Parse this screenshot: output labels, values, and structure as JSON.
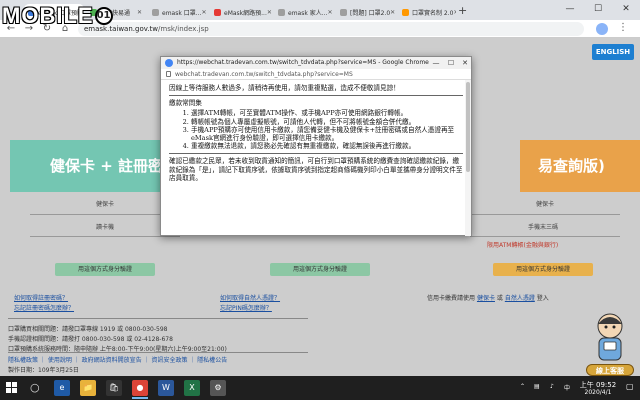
{
  "logo": {
    "text": "MOBILE",
    "badge": "01"
  },
  "tabs": [
    {
      "label": "eMask 口罩預購",
      "fav": "#3c78d8"
    },
    {
      "label": "健保快易通",
      "fav": "#4caf50"
    },
    {
      "label": "emask 口罩...",
      "fav": "#9e9e9e"
    },
    {
      "label": "eMask網路預...",
      "fav": "#e53935"
    },
    {
      "label": "emask 家人...",
      "fav": "#9e9e9e"
    },
    {
      "label": "[問題] 口罩2.0",
      "fav": "#9e9e9e"
    },
    {
      "label": "口罩實名制 2.0",
      "fav": "#ff9800"
    }
  ],
  "window": {
    "minimize": "—",
    "maximize": "☐",
    "close": "✕",
    "new_tab": "+"
  },
  "address": {
    "url_host": "emask.taiwan.gov.tw",
    "url_path": "/msk/index.jsp"
  },
  "page": {
    "english_button": "ENGLISH",
    "banner_left": "健保卡 + 註冊密碼",
    "banner_right": "易查詢版)",
    "label_card": "健保卡",
    "label_card_no": "讀卡機",
    "label_right_card": "健保卡",
    "label_right_reader": "手機末三碼",
    "red_note": "限用ATM轉帳(金融與銀行)",
    "auth_button": "用這個方式身分驗證",
    "links_left_1": "如何取得註冊密碼？",
    "links_left_2": "忘記註冊密碼怎麼辦？",
    "links_mid_1": "如何取得自然人憑證？",
    "links_mid_2": "忘記PIN碼怎麼辦？",
    "right_info_prefix": "信用卡繳費請使用",
    "right_info_link1": "健保卡",
    "right_info_mid": "或",
    "right_info_link2": "自然人憑證",
    "right_info_suffix": "登入",
    "info_1": "口罩購買相關問題：請撥口罩專線 1919 或 0800-030-598",
    "info_2": "手機認證相關問題：請撥打 0800-030-598 或 02-4128-678",
    "info_3": "口罩預購系統服務時間：隨申隨辦 上午8:00-下午9:00(星期六)上午9:00至21:00)",
    "footer_links": "隱私權政策 ｜ 使用說明 ｜ 政府網站資料開放宣告 ｜ 資訊安全政策 ｜ 隱私權公告",
    "update_date": "製作日期：109年3月25日",
    "mascot_label": "線上客服"
  },
  "popup": {
    "title": "https://webchat.tradevan.com.tw/switch_tdvdata.php?service=MS - Google Chrome",
    "url": "webchat.tradevan.com.tw/switch_tdvdata.php?service=MS",
    "notice": "因線上等待服務人數過多，請稍待再使用，請勿重複點選，造成不便敬請見諒！",
    "heading": "繳款常問集",
    "faq": [
      "選擇ATM轉帳，可至實體ATM操作、或手機APP亦可使用網路銀行轉帳。",
      "轉帳帳號為個人專屬虛擬帳號，可請他人代轉，但不可將帳號金額合併代繳。",
      "手機APP預購亦可使用信用卡繳款，請您備妥健卡機及健保卡+註冊密碼或自然人憑證再至eMask官網進行身份驗證，即可選擇信用卡繳款。",
      "重複繳款無法退款，請您務必先確認有無重複繳款，確認無誤後再進行繳款。"
    ],
    "bottom": "確認已繳款之民眾，若未收到取貨通知的簡訊，可自行到口罩預購系統的繳費查詢確認繳款紀錄，繳款紀錄為「是」，請記下取貨序號，依據取貨序號到指定超商條碼機列印小白單並攜帶身分證明文件至店員取貨。"
  },
  "taskbar": {
    "apps": [
      "e",
      "📁",
      "🛍",
      "●",
      "W",
      "X",
      "⚙"
    ],
    "time": "上午 09:52",
    "date": "2020/4/1"
  }
}
